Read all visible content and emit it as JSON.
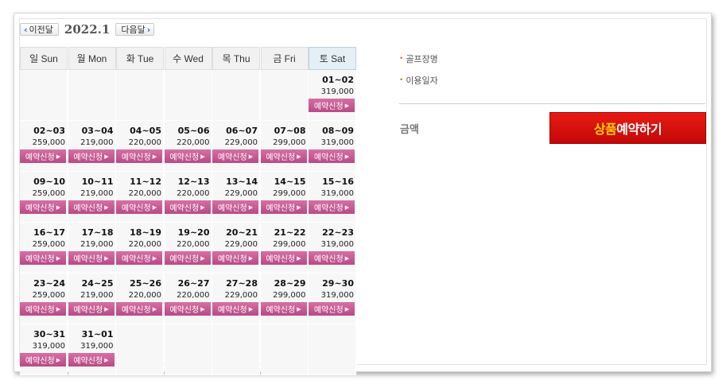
{
  "nav": {
    "prev_label": "이전달",
    "next_label": "다음달",
    "month": "2022.1"
  },
  "weekdays": [
    "일 Sun",
    "월 Mon",
    "화 Tue",
    "수 Wed",
    "목 Thu",
    "금 Fri",
    "토 Sat"
  ],
  "book_label": "예약신청",
  "weeks": [
    [
      null,
      null,
      null,
      null,
      null,
      null,
      {
        "range": "01~02",
        "price": "319,000"
      }
    ],
    [
      {
        "range": "02~03",
        "price": "259,000"
      },
      {
        "range": "03~04",
        "price": "219,000"
      },
      {
        "range": "04~05",
        "price": "220,000"
      },
      {
        "range": "05~06",
        "price": "220,000"
      },
      {
        "range": "06~07",
        "price": "229,000"
      },
      {
        "range": "07~08",
        "price": "299,000"
      },
      {
        "range": "08~09",
        "price": "319,000"
      }
    ],
    [
      {
        "range": "09~10",
        "price": "259,000"
      },
      {
        "range": "10~11",
        "price": "219,000"
      },
      {
        "range": "11~12",
        "price": "220,000"
      },
      {
        "range": "12~13",
        "price": "220,000"
      },
      {
        "range": "13~14",
        "price": "229,000"
      },
      {
        "range": "14~15",
        "price": "299,000"
      },
      {
        "range": "15~16",
        "price": "319,000"
      }
    ],
    [
      {
        "range": "16~17",
        "price": "259,000"
      },
      {
        "range": "17~18",
        "price": "219,000"
      },
      {
        "range": "18~19",
        "price": "220,000"
      },
      {
        "range": "19~20",
        "price": "220,000"
      },
      {
        "range": "20~21",
        "price": "229,000"
      },
      {
        "range": "21~22",
        "price": "299,000"
      },
      {
        "range": "22~23",
        "price": "319,000"
      }
    ],
    [
      {
        "range": "23~24",
        "price": "259,000"
      },
      {
        "range": "24~25",
        "price": "219,000"
      },
      {
        "range": "25~26",
        "price": "220,000"
      },
      {
        "range": "26~27",
        "price": "220,000"
      },
      {
        "range": "27~28",
        "price": "229,000"
      },
      {
        "range": "28~29",
        "price": "299,000"
      },
      {
        "range": "29~30",
        "price": "319,000"
      }
    ],
    [
      {
        "range": "30~31",
        "price": "319,000"
      },
      {
        "range": "31~01",
        "price": "319,000"
      },
      null,
      null,
      null,
      null,
      null
    ]
  ],
  "info": {
    "golf_course_label": "골프장명",
    "use_date_label": "이용일자",
    "amount_label": "금액"
  },
  "reserve": {
    "part1": "상품",
    "part2": "예약하기"
  },
  "colors": {
    "book_button": "#c4568f",
    "reserve_button": "#d8100b",
    "reserve_highlight": "#ffd200",
    "sat_header": "#e4f0f6"
  }
}
